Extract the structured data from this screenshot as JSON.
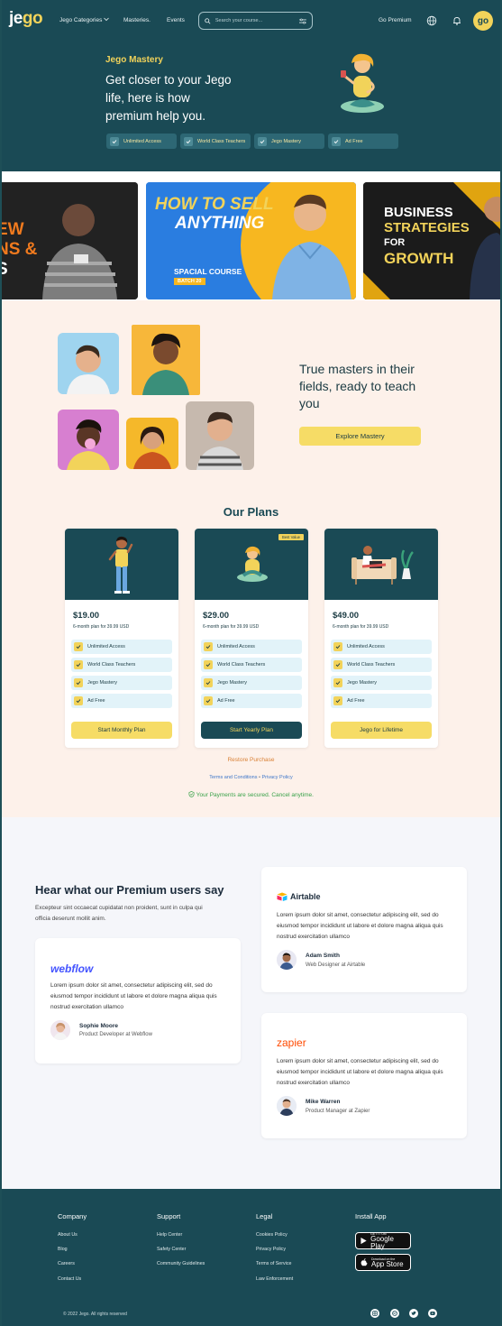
{
  "nav": {
    "logo_main": "je",
    "logo_accent": "go",
    "categories": "Jego Categories",
    "masteries": "Masteries.",
    "events": "Events",
    "search_placeholder": "Search your course...",
    "go_premium": "Go Premium",
    "avatar_text": "go"
  },
  "hero": {
    "kicker": "Jego Mastery",
    "title": "Get closer to your Jego life, here is how premium help you.",
    "pills": [
      "Unlimited Access",
      "World Class Teachers",
      "Jego Mastery",
      "Ad Free"
    ]
  },
  "banners": {
    "left_text_lines": [
      "EW",
      "NS &",
      "S"
    ],
    "how_to_sell_1": "HOW TO SELL",
    "how_to_sell_2": "ANYTHING",
    "special_course": "SPACIAL COURSE",
    "batch": "BATCH 20",
    "business": "BUSINESS",
    "strategies": "STRATEGIES",
    "for": "FOR",
    "growth": "GROWTH"
  },
  "masters": {
    "text": "True masters in their fields, ready to teach you",
    "button": "Explore Mastery"
  },
  "plans": {
    "title": "Our Plans",
    "best_value": "Best Value",
    "cards": [
      {
        "price": "$19.00",
        "sub": "6-month plan for 39.99 USD",
        "features": [
          "Unlimited Access",
          "World Class Teachers",
          "Jego Mastery",
          "Ad Free"
        ],
        "button": "Start Monthly Plan"
      },
      {
        "price": "$29.00",
        "sub": "6-month plan for 39.99 USD",
        "features": [
          "Unlimited Access",
          "World Class Teachers",
          "Jego Mastery",
          "Ad Free"
        ],
        "button": "Start Yearly Plan"
      },
      {
        "price": "$49.00",
        "sub": "6-month plan for 39.99 USD",
        "features": [
          "Unlimited Access",
          "World Class Teachers",
          "Jego Mastery",
          "Ad Free"
        ],
        "button": "Jego for Lifetime"
      }
    ],
    "restore": "Restore Purchase",
    "terms": "Terms and Conditions",
    "privacy": "Privacy Policy",
    "separator": "•",
    "secure": "Your Payments are secured. Cancel anytime."
  },
  "testimonials": {
    "title": "Hear what our Premium users say",
    "subtitle": "Excepteur sint occaecat cupidatat non proident, sunt in culpa qui officia deserunt mollit anim.",
    "quote": "Lorem ipsum dolor sit amet, consectetur adipiscing elit, sed do eiusmod tempor incididunt ut labore et dolore magna aliqua quis nostrud exercitation ullamco",
    "items": [
      {
        "brand": "webflow",
        "name": "Sophie Moore",
        "role": "Product Developer at Webflow"
      },
      {
        "brand": "Airtable",
        "name": "Adam Smith",
        "role": "Web Designer at Airtable"
      },
      {
        "brand": "zapier",
        "name": "Mike Warren",
        "role": "Product Manager at Zapier"
      }
    ]
  },
  "footer": {
    "company": {
      "head": "Company",
      "links": [
        "About Us",
        "Blog",
        "Careers",
        "Contact Us"
      ]
    },
    "support": {
      "head": "Support",
      "links": [
        "Help Center",
        "Safety Center",
        "Community Guidelines"
      ]
    },
    "legal": {
      "head": "Legal",
      "links": [
        "Cookies Policy",
        "Privacy Policy",
        "Terms of Service",
        "Law Enforcement"
      ]
    },
    "install": {
      "head": "Install App",
      "google_small": "GET IT ON",
      "google_big": "Google Play",
      "apple_small": "Download on the",
      "apple_big": "App Store"
    },
    "copyright": "© 2022 Jego. All rights reserved"
  },
  "colors": {
    "brand_dark": "#1a4a55",
    "accent_yellow": "#f2d35a",
    "page_bg": "#fdf1ea",
    "testimonial_bg": "#f5f6fa"
  }
}
